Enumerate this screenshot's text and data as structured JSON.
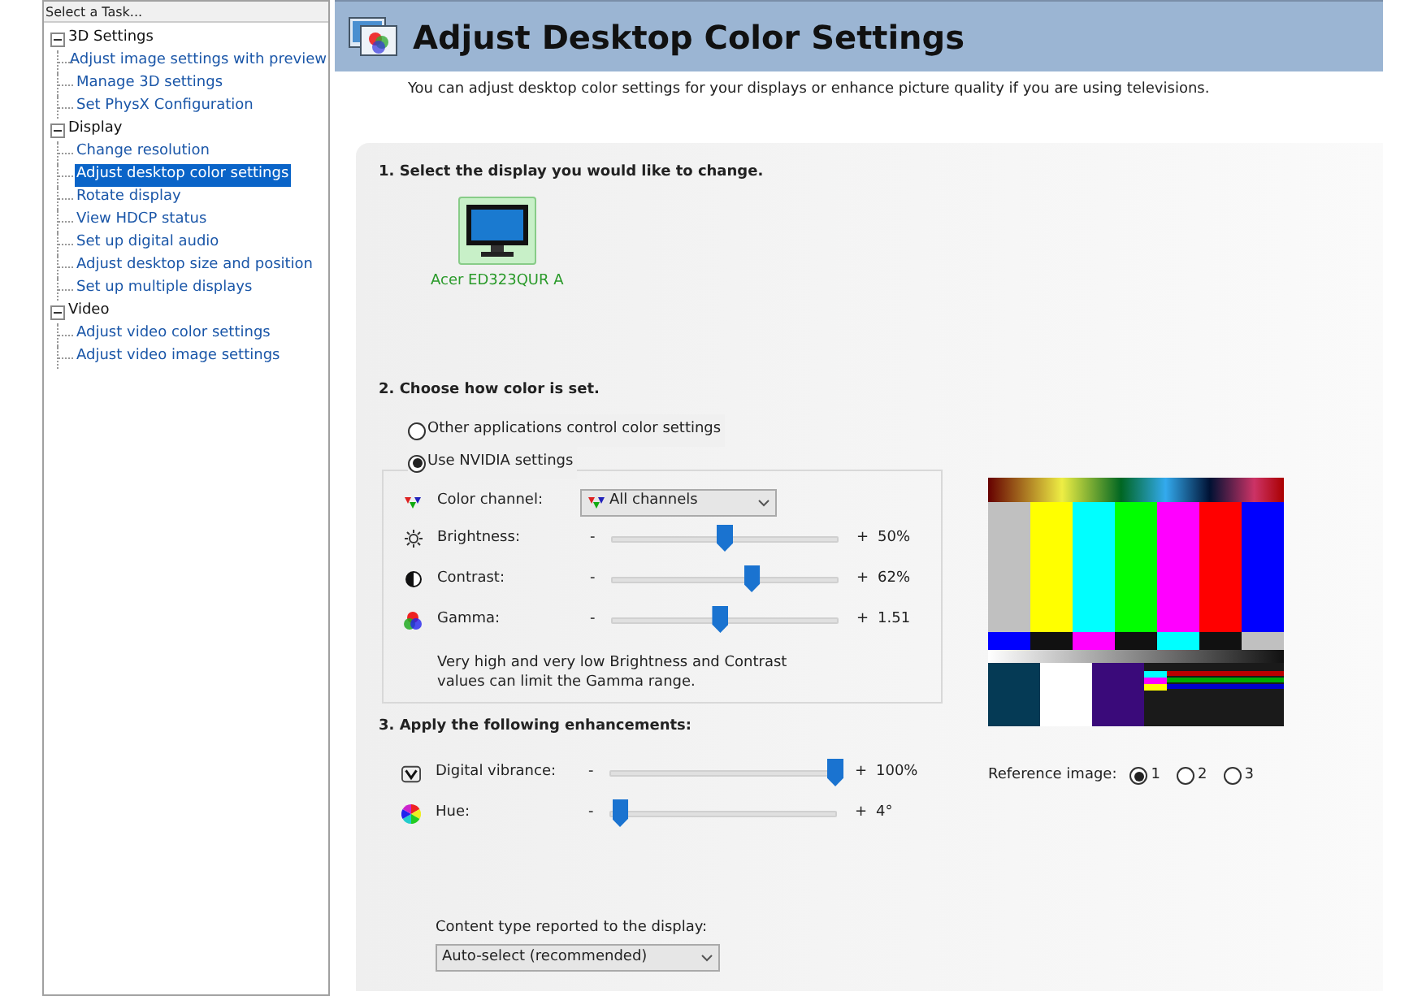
{
  "sidebar": {
    "header": "Select a Task...",
    "tree": [
      {
        "label": "3D Settings",
        "expanded": true,
        "children": [
          {
            "label": "Adjust image settings with preview",
            "selected": false
          },
          {
            "label": "Manage 3D settings",
            "selected": false
          },
          {
            "label": "Set PhysX Configuration",
            "selected": false
          }
        ]
      },
      {
        "label": "Display",
        "expanded": true,
        "children": [
          {
            "label": "Change resolution",
            "selected": false
          },
          {
            "label": "Adjust desktop color settings",
            "selected": true
          },
          {
            "label": "Rotate display",
            "selected": false
          },
          {
            "label": "View HDCP status",
            "selected": false
          },
          {
            "label": "Set up digital audio",
            "selected": false
          },
          {
            "label": "Adjust desktop size and position",
            "selected": false
          },
          {
            "label": "Set up multiple displays",
            "selected": false
          }
        ]
      },
      {
        "label": "Video",
        "expanded": true,
        "children": [
          {
            "label": "Adjust video color settings",
            "selected": false
          },
          {
            "label": "Adjust video image settings",
            "selected": false
          }
        ]
      }
    ]
  },
  "page": {
    "title": "Adjust Desktop Color Settings",
    "description": "You can adjust desktop color settings for your displays or enhance picture quality if you are using televisions.",
    "section1": {
      "heading": "1. Select the display you would like to change.",
      "displays": [
        {
          "label": "Acer ED323QUR A",
          "selected": true
        }
      ]
    },
    "section2": {
      "heading": "2. Choose how color is set.",
      "modes": [
        {
          "label": "Other applications control color settings",
          "selected": false
        },
        {
          "label": "Use NVIDIA settings",
          "selected": true
        }
      ],
      "color_channel": {
        "label": "Color channel:",
        "value": "All channels"
      },
      "sliders": [
        {
          "kind": "brightness",
          "label": "Brightness:",
          "minus": "-",
          "plus": "+",
          "level": 0.5,
          "reading": "50%"
        },
        {
          "kind": "contrast",
          "label": "Contrast:",
          "minus": "-",
          "plus": "+",
          "level": 0.62,
          "reading": "62%"
        },
        {
          "kind": "gamma",
          "label": "Gamma:",
          "minus": "-",
          "plus": "+",
          "level": 0.48,
          "reading": "1.51"
        }
      ],
      "note": "Very high and very low Brightness and Contrast values can limit the Gamma range."
    },
    "section3": {
      "heading": "3. Apply the following enhancements:",
      "sliders": [
        {
          "kind": "vibrance",
          "label": "Digital vibrance:",
          "minus": "-",
          "plus": "+",
          "level": 1.0,
          "reading": "100%"
        },
        {
          "kind": "hue",
          "label": "Hue:",
          "minus": "-",
          "plus": "+",
          "level": 0.04,
          "reading": "4°"
        }
      ],
      "content_type": {
        "label": "Content type reported to the display:",
        "value": "Auto-select (recommended)"
      }
    },
    "reference": {
      "label": "Reference image:",
      "options": [
        {
          "label": "1",
          "selected": true
        },
        {
          "label": "2",
          "selected": false
        },
        {
          "label": "3",
          "selected": false
        }
      ]
    }
  }
}
